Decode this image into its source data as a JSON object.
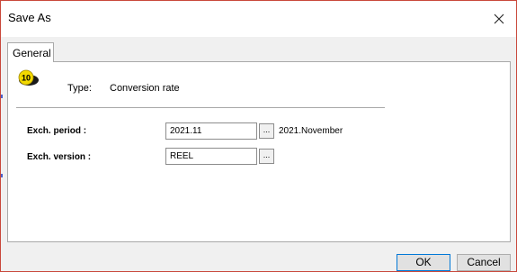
{
  "window": {
    "title": "Save As"
  },
  "tabs": [
    {
      "label": "General"
    }
  ],
  "type_row": {
    "icon_number": "10",
    "label": "Type:",
    "value": "Conversion rate"
  },
  "fields": {
    "period": {
      "label": "Exch. period :",
      "value": "2021.11",
      "description": "2021.November"
    },
    "version": {
      "label": "Exch. version :",
      "value": "REEL"
    }
  },
  "buttons": {
    "ellipsis": "...",
    "ok": "OK",
    "cancel": "Cancel"
  }
}
